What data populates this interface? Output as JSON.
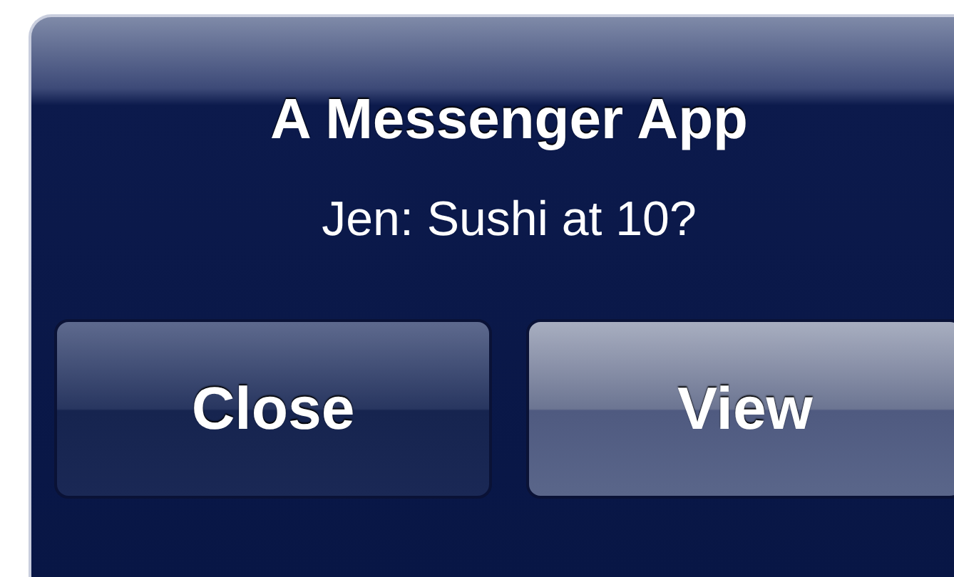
{
  "alert": {
    "title": "A Messenger App",
    "message": "Jen: Sushi at 10?",
    "buttons": [
      {
        "label": "Close",
        "kind": "cancel"
      },
      {
        "label": "View",
        "kind": "default"
      }
    ]
  }
}
